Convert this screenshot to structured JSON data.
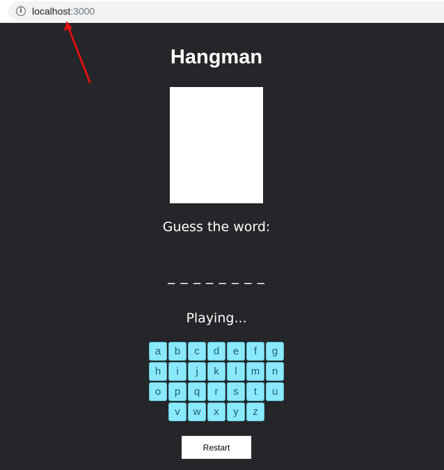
{
  "browser": {
    "url_host": "localhost",
    "url_port": ":3000"
  },
  "game": {
    "title": "Hangman",
    "prompt": "Guess the word:",
    "masked_word": "_ _ _ _ _ _ _ _",
    "status": "Playing...",
    "restart_label": "Restart"
  },
  "keyboard": {
    "row1": [
      "a",
      "b",
      "c",
      "d",
      "e",
      "f",
      "g"
    ],
    "row2": [
      "h",
      "i",
      "j",
      "k",
      "l",
      "m",
      "n"
    ],
    "row3": [
      "o",
      "p",
      "q",
      "r",
      "s",
      "t",
      "u"
    ],
    "row4": [
      "v",
      "w",
      "x",
      "y",
      "z"
    ]
  },
  "colors": {
    "background": "#25262a",
    "key_fill": "#8be9fd",
    "arrow": "#e01010"
  }
}
